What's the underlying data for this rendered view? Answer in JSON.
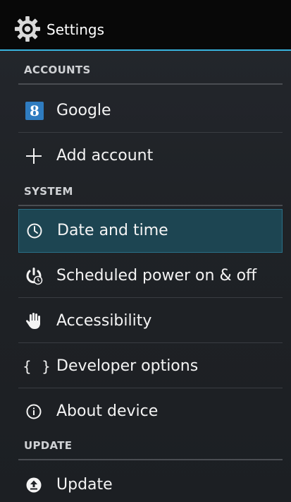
{
  "action_bar": {
    "title": "Settings",
    "icon": "gear-icon",
    "accent_color": "#38b4de"
  },
  "sections": {
    "accounts": {
      "title": "ACCOUNTS",
      "items": [
        {
          "label": "Google",
          "icon": "google-account-icon",
          "icon_text": "8"
        },
        {
          "label": "Add account",
          "icon": "plus-icon"
        }
      ]
    },
    "system": {
      "title": "SYSTEM",
      "items": [
        {
          "label": "Date and time",
          "icon": "clock-icon",
          "selected": true
        },
        {
          "label": "Scheduled power on & off",
          "icon": "scheduled-power-icon"
        },
        {
          "label": "Accessibility",
          "icon": "hand-icon"
        },
        {
          "label": "Developer options",
          "icon": "braces-icon",
          "icon_text": "{ }"
        },
        {
          "label": "About device",
          "icon": "info-icon"
        }
      ]
    },
    "update": {
      "title": "UPDATE",
      "items": [
        {
          "label": "Update",
          "icon": "upload-icon"
        }
      ]
    }
  },
  "colors": {
    "background": "#1f2226",
    "selected_background": "#1d4552",
    "selected_border": "#2a6f86",
    "google_badge": "#2f7cc0"
  }
}
